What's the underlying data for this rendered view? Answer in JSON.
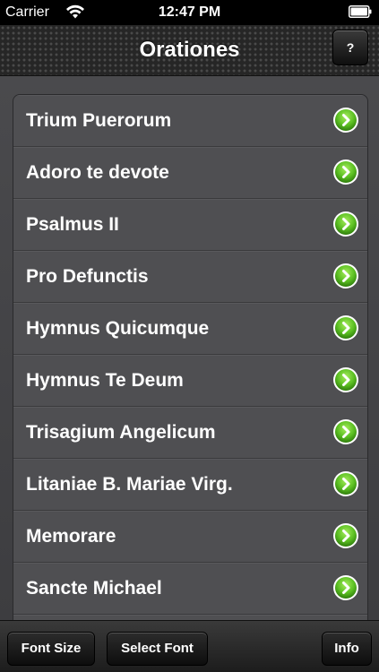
{
  "status_bar": {
    "carrier": "Carrier",
    "time": "12:47 PM",
    "wifi_icon": "wifi-icon",
    "battery_icon": "battery-icon"
  },
  "nav": {
    "title": "Orationes",
    "help_label": "?"
  },
  "list": {
    "items": [
      {
        "label": "Trium Puerorum"
      },
      {
        "label": "Adoro te devote"
      },
      {
        "label": "Psalmus II"
      },
      {
        "label": "Pro Defunctis"
      },
      {
        "label": "Hymnus Quicumque"
      },
      {
        "label": "Hymnus Te Deum"
      },
      {
        "label": "Trisagium Angelicum"
      },
      {
        "label": "Litaniae B. Mariae Virg."
      },
      {
        "label": "Memorare"
      },
      {
        "label": "Sancte Michael"
      },
      {
        "label": ""
      }
    ],
    "accessory_icon": "chevron-right-circle-icon"
  },
  "toolbar": {
    "font_size_label": "Font Size",
    "select_font_label": "Select Font",
    "info_label": "Info"
  },
  "colors": {
    "accessory_green": "#5bbf22",
    "nav_background": "#262626"
  }
}
